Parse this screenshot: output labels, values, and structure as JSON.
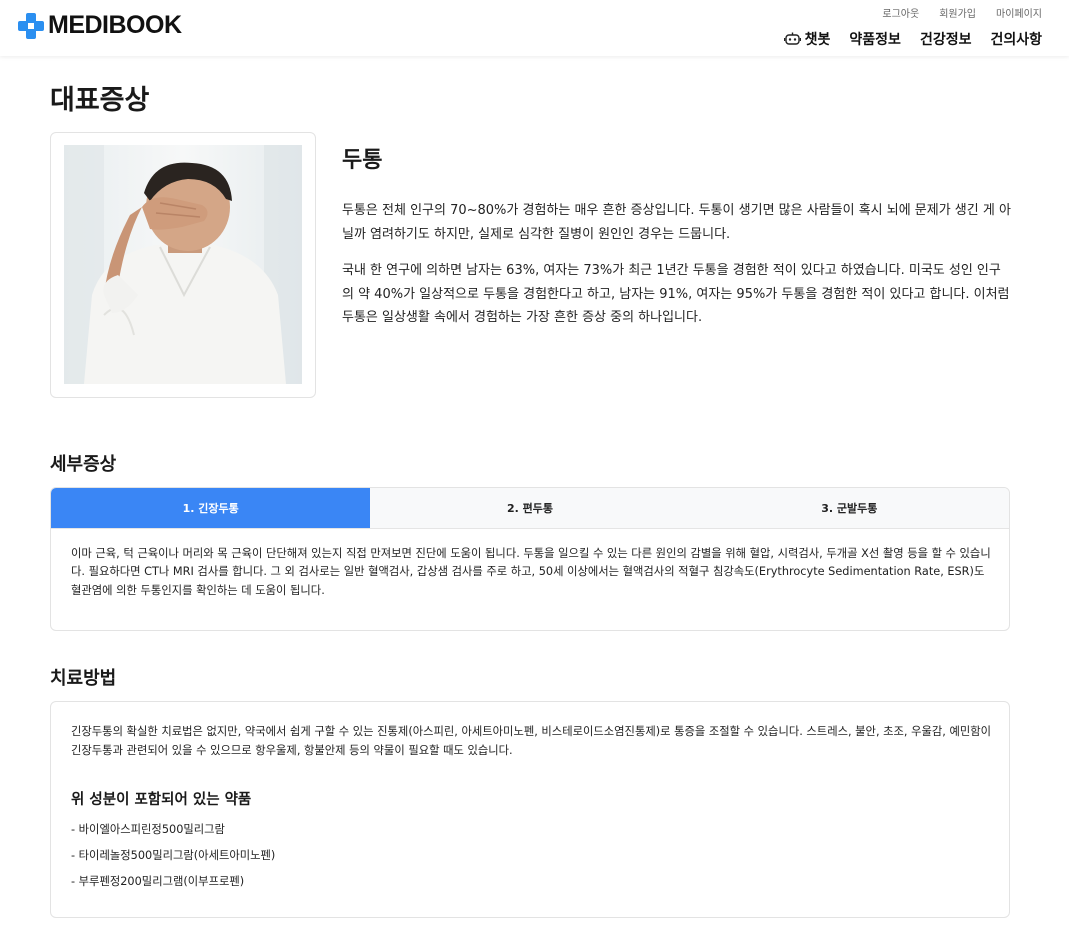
{
  "header": {
    "logo_text": "MEDIBOOK",
    "brand_color": "#2b8ff0",
    "util_nav": [
      "로그아웃",
      "회원가입",
      "마이페이지"
    ],
    "main_nav": [
      "챗봇",
      "약품정보",
      "건강정보",
      "건의사항"
    ]
  },
  "page": {
    "title": "대표증상"
  },
  "symptom": {
    "name": "두통",
    "image_icon": "man-holding-head-photo",
    "paragraphs": [
      "두통은 전체 인구의 70~80%가 경험하는 매우 흔한 증상입니다. 두통이 생기면 많은 사람들이 혹시 뇌에 문제가 생긴 게 아닐까 염려하기도 하지만, 실제로 심각한 질병이 원인인 경우는 드뭅니다.",
      "국내 한 연구에 의하면 남자는 63%, 여자는 73%가 최근 1년간 두통을 경험한 적이 있다고 하였습니다. 미국도 성인 인구의 약 40%가 일상적으로 두통을 경험한다고 하고, 남자는 91%, 여자는 95%가 두통을 경험한 적이 있다고 합니다. 이처럼 두통은 일상생활 속에서 경험하는 가장 흔한 증상 중의 하나입니다."
    ]
  },
  "details": {
    "title": "세부증상",
    "tabs": [
      "1. 긴장두통",
      "2. 편두통",
      "3. 군발두통"
    ],
    "active_tab": 0,
    "active_color": "#3a86f5",
    "content": "이마 근육, 턱 근육이나 머리와 목 근육이 단단해져 있는지 직접 만져보면 진단에 도움이 됩니다. 두통을 일으킬 수 있는 다른 원인의 감별을 위해 혈압, 시력검사, 두개골 X선 촬영 등을 할 수 있습니다. 필요하다면 CT나 MRI 검사를 합니다. 그 외 검사로는 일반 혈액검사, 갑상샘 검사를 주로 하고, 50세 이상에서는 혈액검사의 적혈구 침강속도(Erythrocyte Sedimentation Rate, ESR)도 혈관염에 의한 두통인지를 확인하는 데 도움이 됩니다."
  },
  "treatment": {
    "title": "치료방법",
    "text": "긴장두통의 확실한 치료법은 없지만, 약국에서 쉽게 구할 수 있는 진통제(아스피린, 아세트아미노펜, 비스테로이드소염진통제)로 통증을 조절할 수 있습니다. 스트레스, 불안, 초조, 우울감, 예민함이 긴장두통과 관련되어 있을 수 있으므로 항우울제, 항불안제 등의 약물이 필요할 때도 있습니다.",
    "medicines_title": "위 성분이 포함되어 있는 약품",
    "medicines": [
      "- 바이엘아스피린정500밀리그람",
      "- 타이레놀정500밀리그람(아세트아미노펜)",
      "- 부루펜정200밀리그램(이부프로펜)"
    ]
  }
}
